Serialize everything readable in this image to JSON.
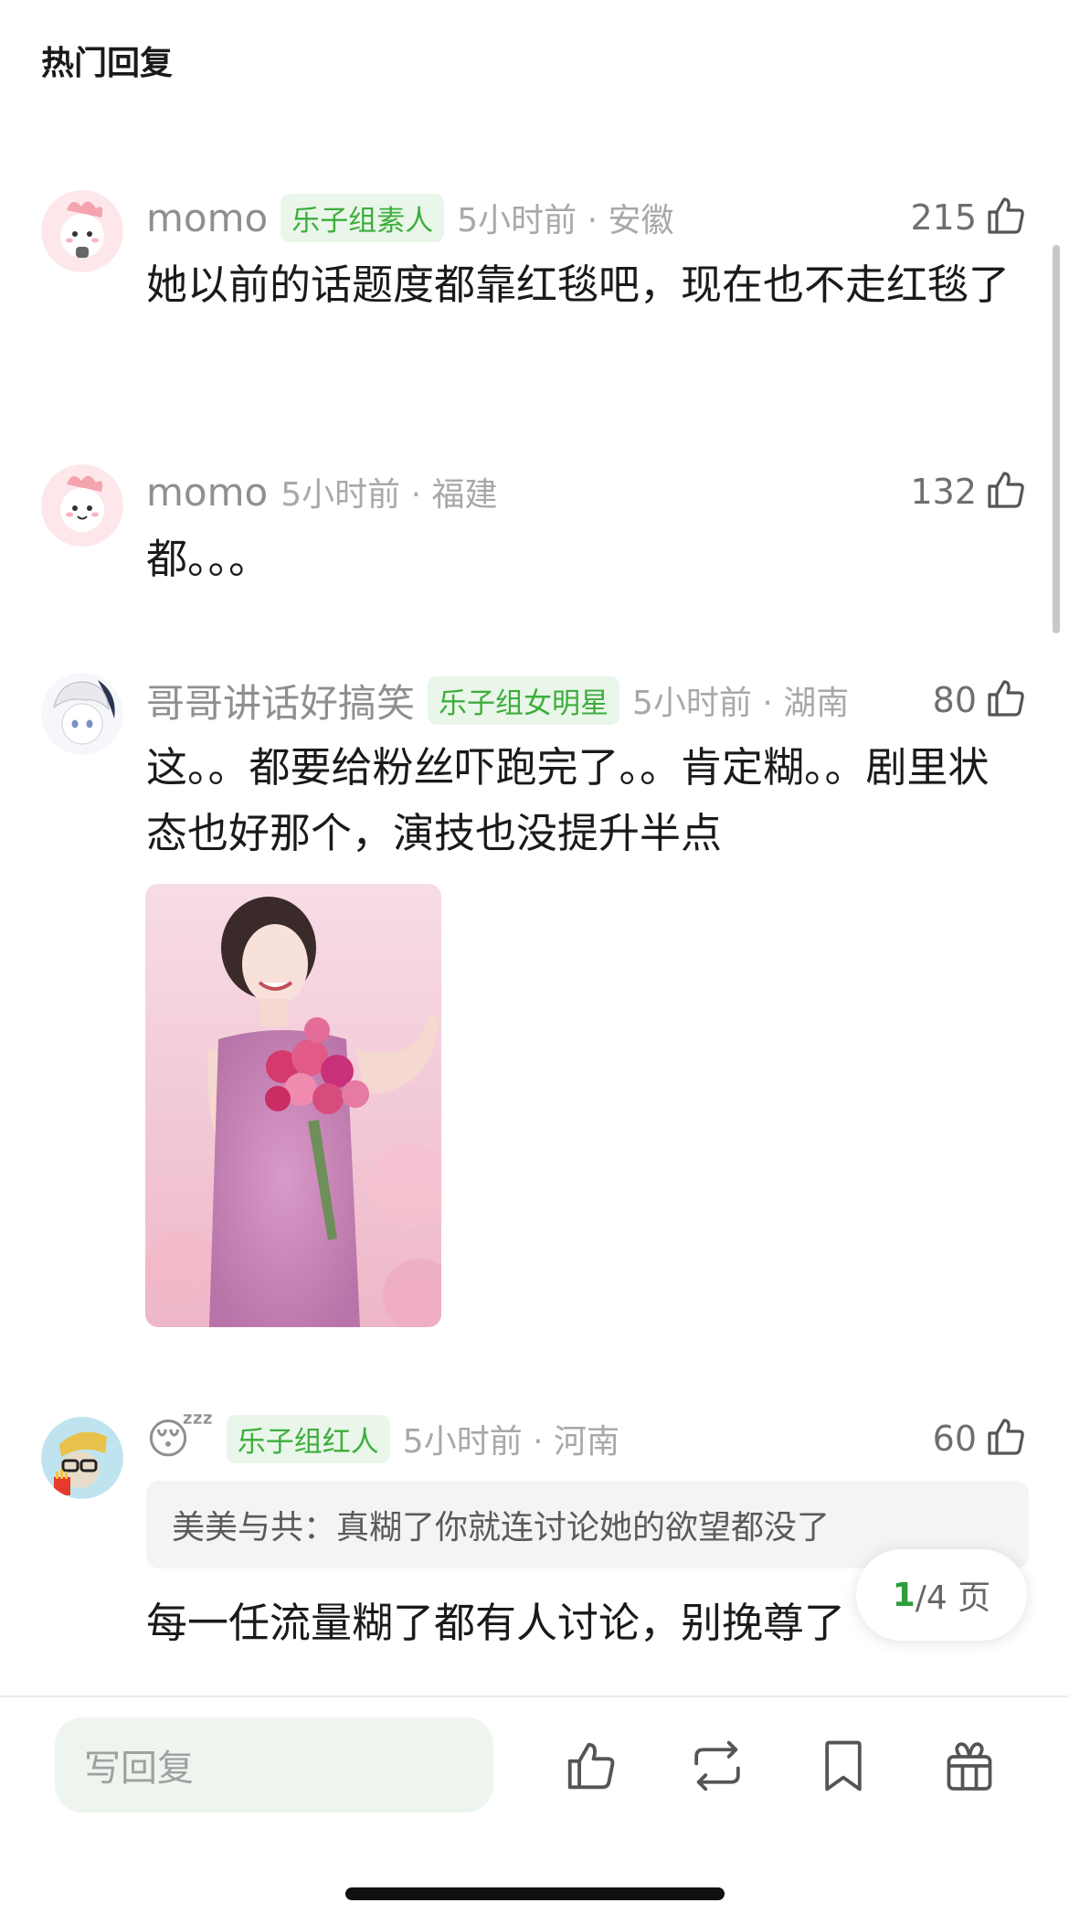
{
  "header": {
    "title": "热门回复"
  },
  "comments": [
    {
      "username": "momo",
      "badge": "乐子组素人",
      "meta": "5小时前 · 安徽",
      "likes": "215",
      "text": "她以前的话题度都靠红毯吧，现在也不走红毯了"
    },
    {
      "username": "momo",
      "badge": "",
      "meta": "5小时前 · 福建",
      "likes": "132",
      "text": "都。。。"
    },
    {
      "username": "哥哥讲话好搞笑",
      "badge": "乐子组女明星",
      "meta": "5小时前 · 湖南",
      "likes": "80",
      "text": "这。。都要给粉丝吓跑完了。。肯定糊。。剧里状态也好那个，演技也没提升半点"
    },
    {
      "username": "😴",
      "badge": "乐子组红人",
      "meta": "5小时前 · 河南",
      "likes": "60",
      "quote": "美美与共：真糊了你就连讨论她的欲望都没了",
      "text": "每一任流量糊了都有人讨论，别挽尊了"
    }
  ],
  "pager": {
    "current": "1",
    "total": "/4 页"
  },
  "bottom_bar": {
    "reply_placeholder": "写回复",
    "icons": [
      "like-icon",
      "repost-icon",
      "bookmark-icon",
      "gift-icon"
    ]
  },
  "colors": {
    "badge_text": "#3cae3c",
    "badge_bg": "#eaf6ea",
    "pager_current": "#2e9e3a",
    "reply_bg": "#eef5ef"
  }
}
